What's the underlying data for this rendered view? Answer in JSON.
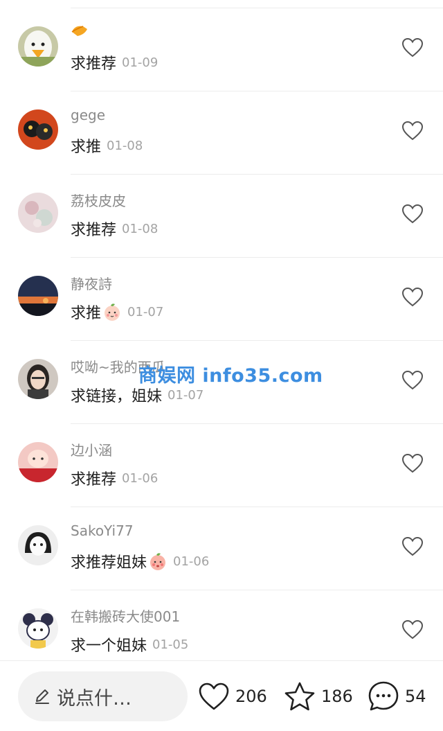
{
  "comments": [
    {
      "name": "",
      "text": "求推荐",
      "date": "01-09",
      "avatar_color": "#d9d3b8",
      "has_name_icon": true
    },
    {
      "name": "gege",
      "text": "求推",
      "date": "01-08",
      "avatar_color": "#c9431f"
    },
    {
      "name": "荔枝皮皮",
      "text": "求推荐",
      "date": "01-08",
      "avatar_color": "#e8d6d8"
    },
    {
      "name": "静夜詩",
      "text": "求推",
      "date": "01-07",
      "avatar_color": "#2b2f45",
      "emoji": "peach-face-emoji"
    },
    {
      "name": "哎呦~我的西瓜",
      "text": "求链接，姐妹",
      "date": "01-07",
      "avatar_color": "#bfb8b3"
    },
    {
      "name": "边小涵",
      "text": "求推荐",
      "date": "01-06",
      "avatar_color": "#d64545"
    },
    {
      "name": "SakoYi77",
      "text": "求推荐姐妹",
      "date": "01-06",
      "avatar_color": "#dcdcdc",
      "emoji": "peach-face-emoji"
    },
    {
      "name": "在韩搬砖大使001",
      "text": "求一个姐妹",
      "date": "01-05",
      "avatar_color": "#3a3f6b"
    }
  ],
  "watermark": "商娱网 info35.com",
  "bottom_bar": {
    "input_placeholder": "说点什…",
    "likes": "206",
    "stars": "186",
    "comments": "54"
  },
  "colors": {
    "name_gray": "#8a8a8a",
    "date_gray": "#a3a3a3",
    "watermark_blue": "#3d8ee0",
    "pill_bg": "#f2f2f2"
  }
}
